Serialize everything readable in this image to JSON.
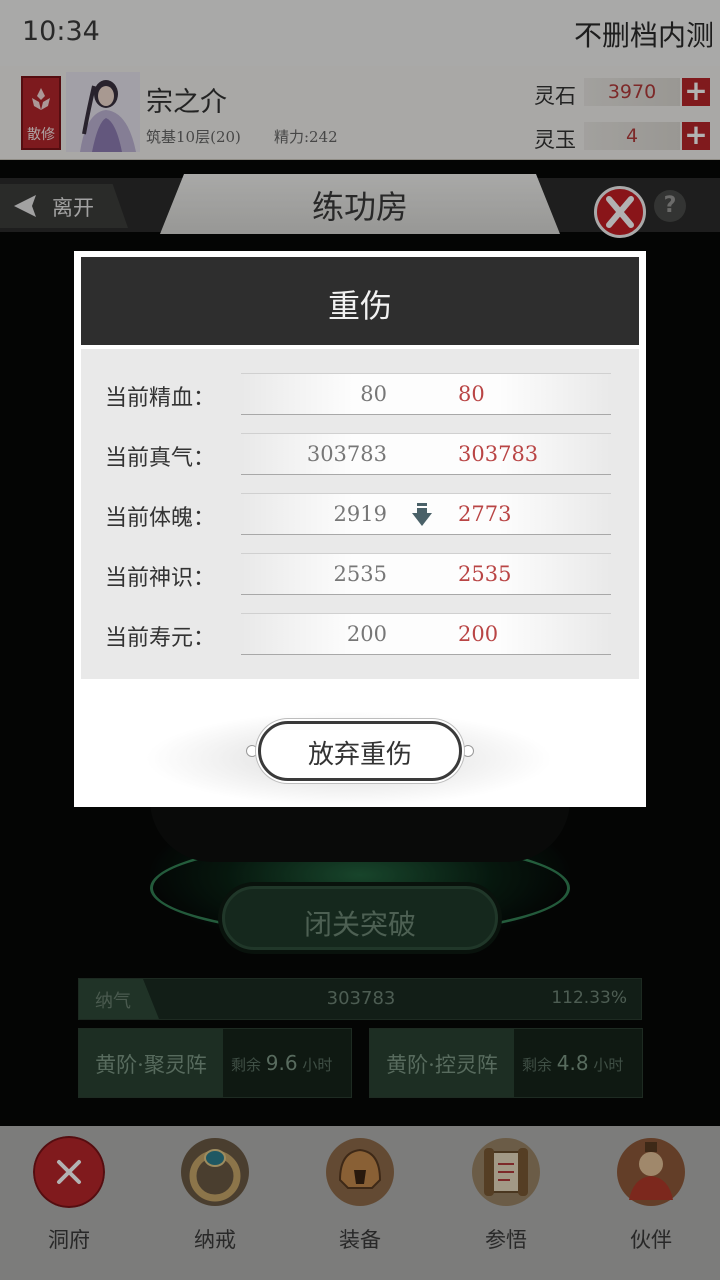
{
  "status": {
    "time": "10:34",
    "test_label": "不删档内测"
  },
  "player": {
    "sect_badge": "散修",
    "name": "宗之介",
    "realm": "筑基10层(20)",
    "stamina": "精力:242"
  },
  "currencies": [
    {
      "label": "灵石",
      "value": "3970",
      "plus_icon": "plus-icon"
    },
    {
      "label": "灵玉",
      "value": "4",
      "plus_icon": "plus-icon"
    }
  ],
  "room": {
    "back_label": "离开",
    "title": "练功房",
    "help_glyph": "?"
  },
  "breakthrough_label": "闭关突破",
  "qi_bar": {
    "label": "纳气",
    "value": "303783",
    "percent": "112.33%"
  },
  "arrays": [
    {
      "name": "黄阶·聚灵阵",
      "remain_prefix": "剩余",
      "remain_value": "9.6",
      "remain_unit": "小时"
    },
    {
      "name": "黄阶·控灵阵",
      "remain_prefix": "剩余",
      "remain_value": "4.8",
      "remain_unit": "小时"
    }
  ],
  "nav": [
    {
      "label": "洞府",
      "icon": "close-icon"
    },
    {
      "label": "纳戒",
      "icon": "ring-icon"
    },
    {
      "label": "装备",
      "icon": "helmet-icon"
    },
    {
      "label": "参悟",
      "icon": "scroll-icon"
    },
    {
      "label": "伙伴",
      "icon": "companion-icon"
    }
  ],
  "modal": {
    "title": "重伤",
    "stats": [
      {
        "label": "当前精血：",
        "current": "80",
        "after": "80"
      },
      {
        "label": "当前真气：",
        "current": "303783",
        "after": "303783"
      },
      {
        "label": "当前体魄：",
        "current": "2919",
        "after": "2773",
        "decrease": true
      },
      {
        "label": "当前神识：",
        "current": "2535",
        "after": "2535"
      },
      {
        "label": "当前寿元：",
        "current": "200",
        "after": "200"
      }
    ],
    "button_label": "放弃重伤"
  },
  "colors": {
    "accent_red": "#b8262a",
    "value_red": "#b94545",
    "modal_header": "#2e2e2e",
    "jade_green": "#2a4333"
  }
}
